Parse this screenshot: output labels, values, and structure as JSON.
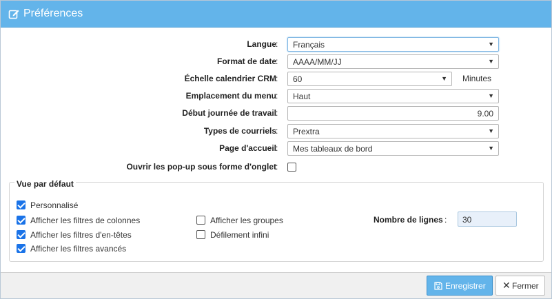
{
  "window": {
    "title": "Préférences",
    "title_icon": "edit-icon"
  },
  "form": {
    "language": {
      "label": "Langue",
      "value": "Français"
    },
    "date_format": {
      "label": "Format de date",
      "value": "AAAA/MM/JJ"
    },
    "calendar_scale": {
      "label": "Échelle calendrier CRM",
      "value": "60",
      "unit": "Minutes"
    },
    "menu_location": {
      "label": "Emplacement du menu",
      "value": "Haut"
    },
    "workday_start": {
      "label": "Début journée de travail",
      "value": "9.00"
    },
    "email_types": {
      "label": "Types de courriels",
      "value": "Prextra"
    },
    "home_page": {
      "label": "Page d'accueil",
      "value": "Mes tableaux de bord"
    },
    "popup_tabs": {
      "label": "Ouvrir les pop-up sous forme d'onglet",
      "checked": false
    },
    "colon": ":"
  },
  "default_view": {
    "legend": "Vue par défaut",
    "custom": {
      "label": "Personnalisé",
      "checked": true
    },
    "column_filters": {
      "label": "Afficher les filtres de colonnes",
      "checked": true
    },
    "header_filters": {
      "label": "Afficher les filtres d'en-têtes",
      "checked": true
    },
    "advanced_filters": {
      "label": "Afficher les filtres avancés",
      "checked": true
    },
    "show_groups": {
      "label": "Afficher les groupes",
      "checked": false
    },
    "infinite_scroll": {
      "label": "Défilement infini",
      "checked": false
    },
    "row_count": {
      "label": "Nombre de lignes",
      "value": "30"
    }
  },
  "footer": {
    "save_label": "Enregistrer",
    "save_icon": "save-icon",
    "close_label": "Fermer",
    "close_icon": "close-icon"
  },
  "colors": {
    "header": "#63b4ea",
    "checkbox": "#1a73e8",
    "footer_bg": "#f0f0f0"
  }
}
